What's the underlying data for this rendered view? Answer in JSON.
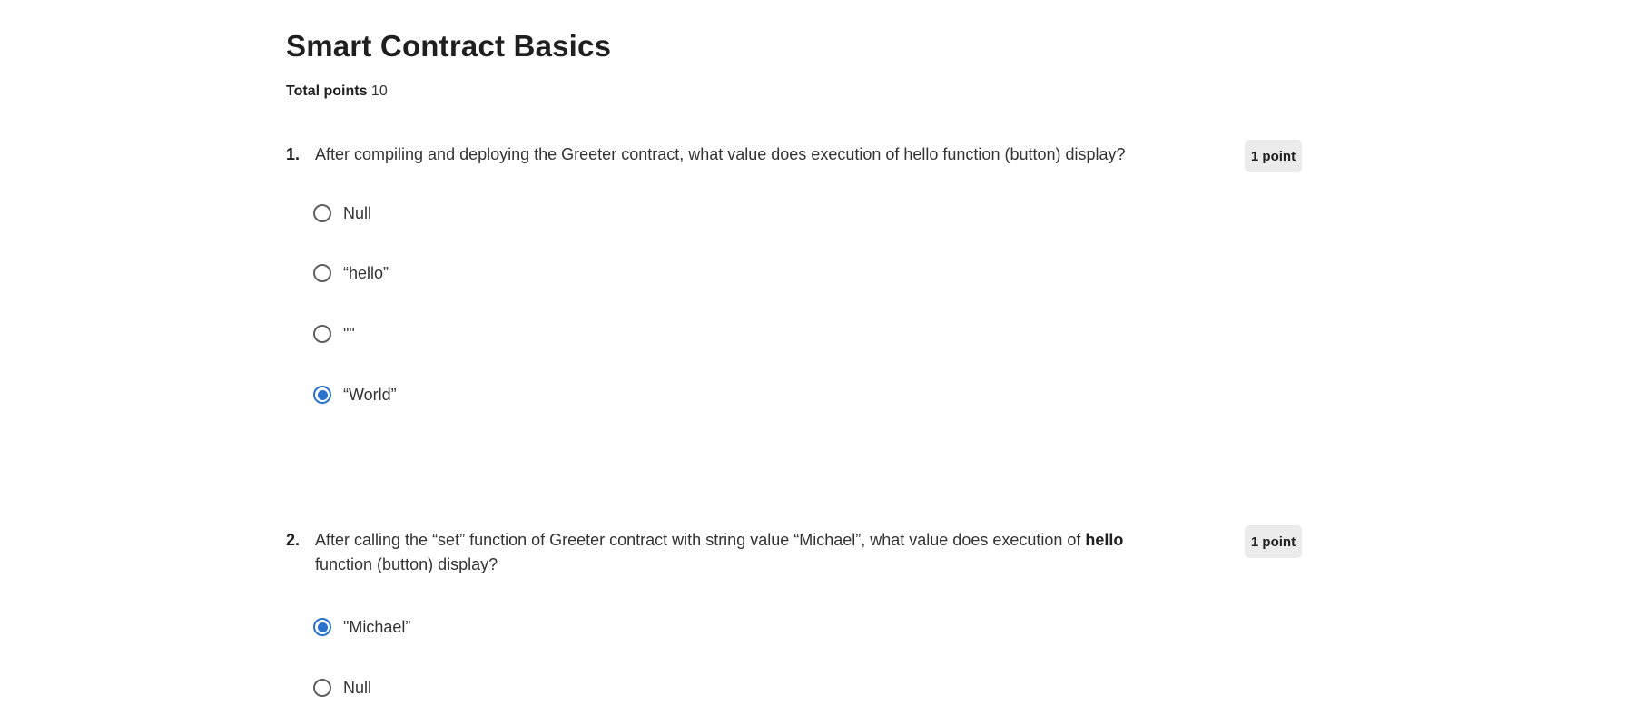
{
  "quiz": {
    "title": "Smart Contract Basics",
    "total_points_label": "Total points",
    "total_points_value": "10"
  },
  "questions": [
    {
      "number": "1.",
      "text_before_bold": "After compiling and deploying the Greeter contract, what value does execution of  hello function (button) display?",
      "text_bold": "",
      "text_after_bold": "",
      "points": "1 point",
      "options": [
        {
          "label": "Null",
          "selected": false
        },
        {
          "label": "“hello”",
          "selected": false
        },
        {
          "label": "\"\"",
          "selected": false
        },
        {
          "label": "“World”",
          "selected": true
        }
      ]
    },
    {
      "number": "2.",
      "text_before_bold": "After calling the “set” function of Greeter contract with string value “Michael”, what value does execution of ",
      "text_bold": "hello",
      "text_after_bold": " function (button) display?",
      "points": "1 point",
      "options": [
        {
          "label": "\"Michael”",
          "selected": true
        },
        {
          "label": "Null",
          "selected": false
        }
      ]
    }
  ],
  "colors": {
    "accent": "#2a73cc",
    "radio_border": "#5f5f5f",
    "badge_background": "#ebebeb",
    "text": "#333333"
  }
}
